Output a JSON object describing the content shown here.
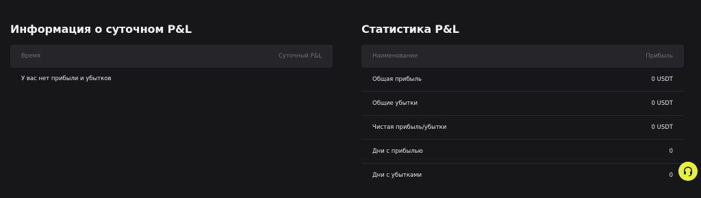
{
  "daily_pnl": {
    "title": "Информация о суточном P&L",
    "columns": {
      "time": "Время",
      "daily_pnl": "Суточный P&L"
    },
    "empty_message": "У вас нет прибыли и убытков"
  },
  "pnl_stats": {
    "title": "Статистика P&L",
    "columns": {
      "name": "Наименование",
      "profit": "Прибыль"
    },
    "rows": [
      {
        "name": "Общая прибыль",
        "value": "0 USDT"
      },
      {
        "name": "Общие убытки",
        "value": "0 USDT"
      },
      {
        "name": "Чистая прибыль/убытки",
        "value": "0 USDT"
      },
      {
        "name": "Дни с прибылью",
        "value": "0"
      },
      {
        "name": "Дни с убытками",
        "value": "0"
      }
    ]
  },
  "support": {
    "icon": "headset-icon",
    "color": "#e8f03a"
  },
  "colors": {
    "background": "#17171a",
    "header_bg": "#25252a",
    "accent": "#e8f03a"
  }
}
